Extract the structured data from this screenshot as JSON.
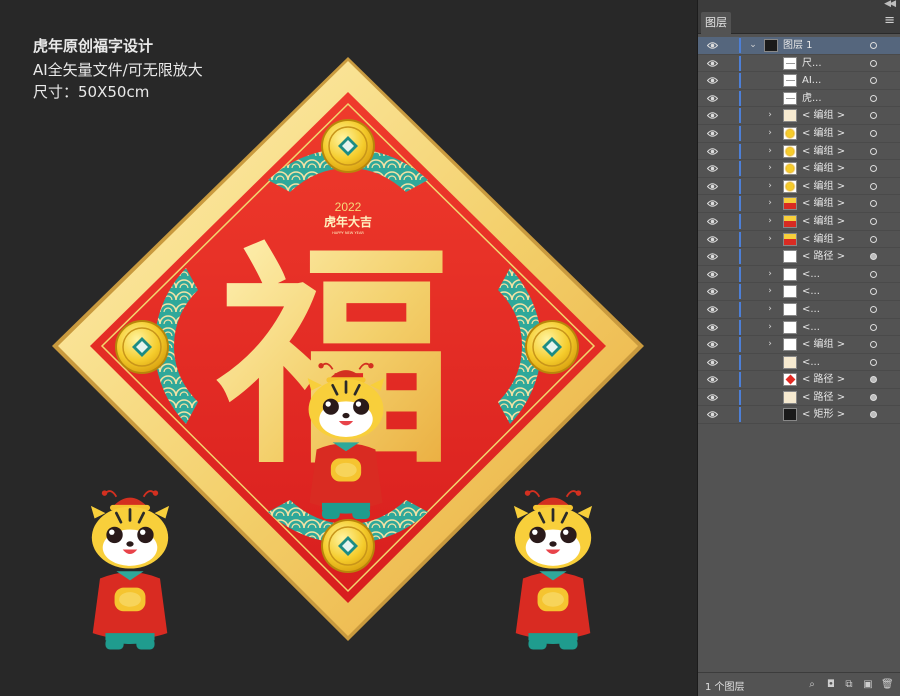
{
  "canvas": {
    "info": {
      "title": "虎年原创福字设计",
      "vector": "AI全矢量文件/可无限放大",
      "size": "尺寸：50X50cm"
    },
    "artwork": {
      "fu_character": "福",
      "year": "2022",
      "slogan": "虎年大吉",
      "slogan_sub": "HAPPY NEW YEAR",
      "colors": {
        "background": "#282828",
        "gold": "#f0d27a",
        "red": "#e32b24",
        "teal": "#2fa89a",
        "coin": "#f2c530"
      }
    }
  },
  "panel": {
    "tab_label": "图层",
    "menu_icon": "hamburger-menu-icon",
    "collapse_icon": "double-chevron-left-icon",
    "layers": [
      {
        "label": "图层 1",
        "expand": "expanded",
        "thumb": "dark",
        "target": "ring",
        "top_level": true,
        "selected": true
      },
      {
        "label": "尺...",
        "expand": "none",
        "thumb": "text",
        "target": "ring"
      },
      {
        "label": "AI...",
        "expand": "none",
        "thumb": "text",
        "target": "ring"
      },
      {
        "label": "虎...",
        "expand": "none",
        "thumb": "text",
        "target": "ring"
      },
      {
        "label": "< 编组 >",
        "expand": "collapsed",
        "thumb": "pale",
        "target": "ring"
      },
      {
        "label": "< 编组 >",
        "expand": "collapsed",
        "thumb": "coin",
        "target": "ring"
      },
      {
        "label": "< 编组 >",
        "expand": "collapsed",
        "thumb": "coin",
        "target": "ring"
      },
      {
        "label": "< 编组 >",
        "expand": "collapsed",
        "thumb": "coin",
        "target": "ring"
      },
      {
        "label": "< 编组 >",
        "expand": "collapsed",
        "thumb": "coin",
        "target": "ring"
      },
      {
        "label": "< 编组 >",
        "expand": "collapsed",
        "thumb": "tiger",
        "target": "ring"
      },
      {
        "label": "< 编组 >",
        "expand": "collapsed",
        "thumb": "tiger",
        "target": "ring"
      },
      {
        "label": "< 编组 >",
        "expand": "collapsed",
        "thumb": "tiger",
        "target": "ring"
      },
      {
        "label": "< 路径 >",
        "expand": "none",
        "thumb": "white",
        "target": "filled"
      },
      {
        "label": "<...",
        "expand": "collapsed",
        "thumb": "white",
        "target": "ring"
      },
      {
        "label": "<...",
        "expand": "collapsed",
        "thumb": "white",
        "target": "ring"
      },
      {
        "label": "<...",
        "expand": "collapsed",
        "thumb": "white",
        "target": "ring"
      },
      {
        "label": "<...",
        "expand": "collapsed",
        "thumb": "white",
        "target": "ring"
      },
      {
        "label": "< 编组 >",
        "expand": "collapsed",
        "thumb": "white",
        "target": "ring"
      },
      {
        "label": "<...",
        "expand": "none",
        "thumb": "pale",
        "target": "ring"
      },
      {
        "label": "< 路径 >",
        "expand": "none",
        "thumb": "red",
        "target": "filled"
      },
      {
        "label": "< 路径 >",
        "expand": "none",
        "thumb": "pale",
        "target": "filled"
      },
      {
        "label": "< 矩形 >",
        "expand": "none",
        "thumb": "dark",
        "target": "filled"
      }
    ],
    "footer": {
      "count": "1 个图层",
      "icons": [
        "locate-object-icon",
        "make-clipping-mask-icon",
        "create-sublayer-icon",
        "create-new-layer-icon",
        "delete-icon"
      ]
    }
  }
}
